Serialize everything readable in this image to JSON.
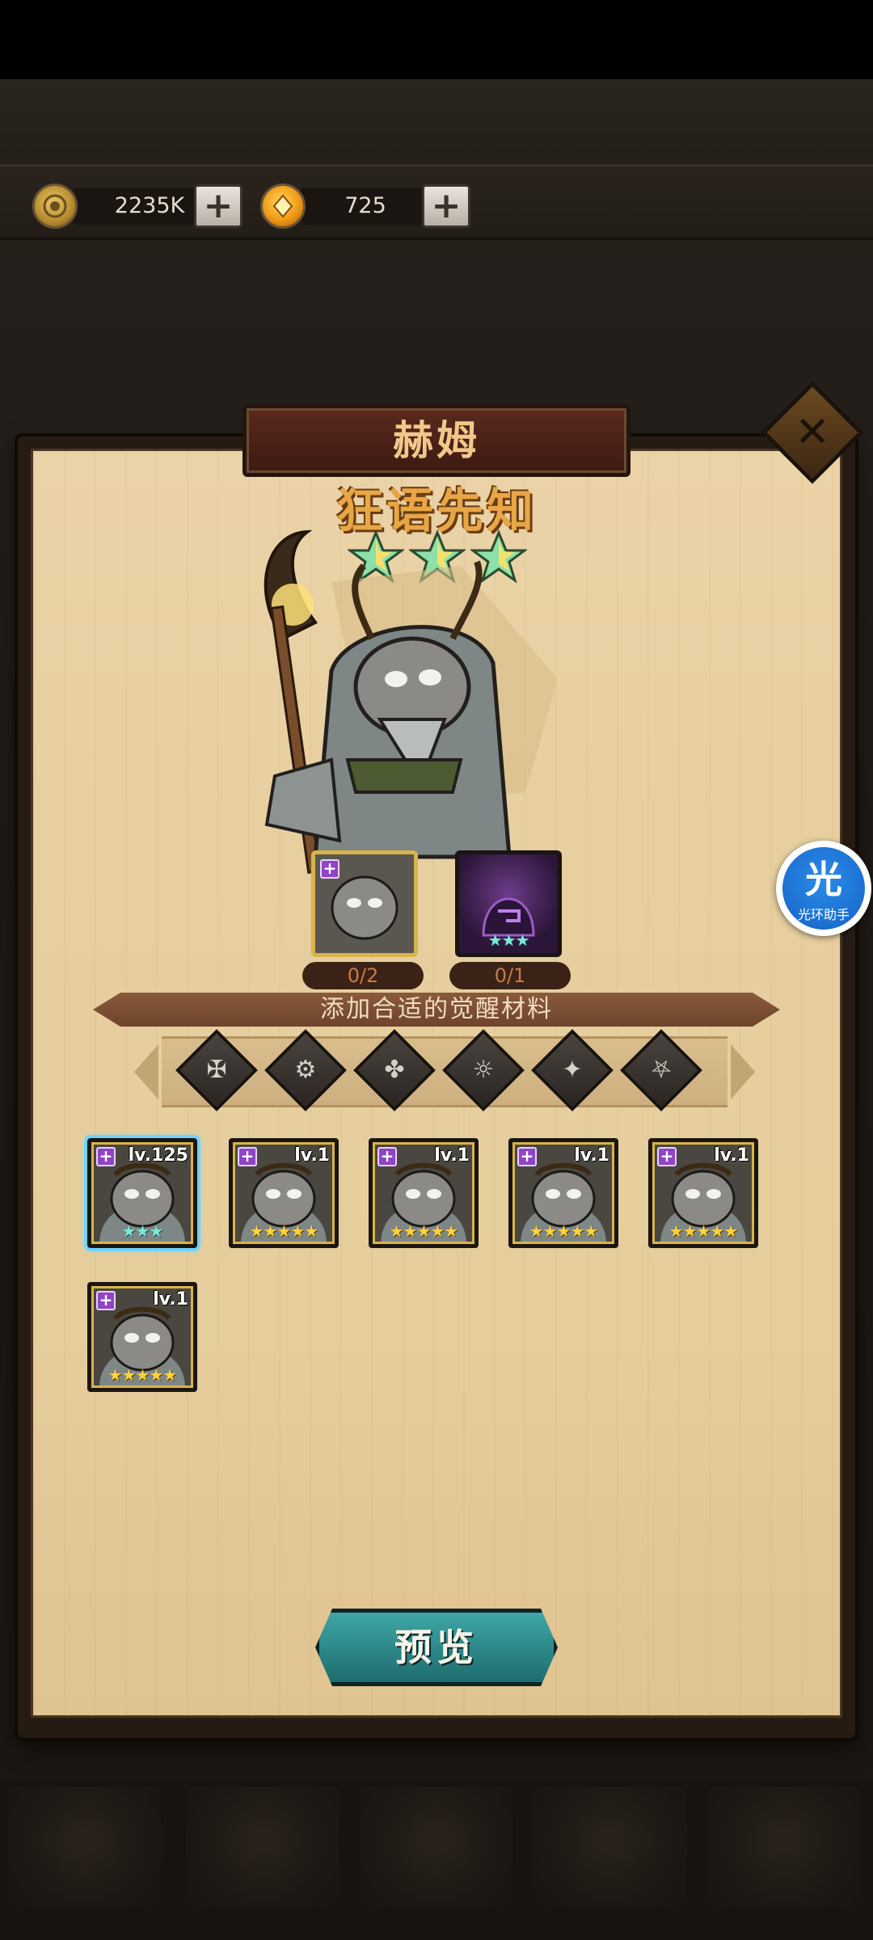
{
  "resources": {
    "gold": {
      "icon": "coin-icon",
      "value": "2235K"
    },
    "gem": {
      "icon": "gem-icon",
      "value": "725"
    }
  },
  "panel": {
    "hero_name": "赫姆",
    "hero_title": "狂语先知",
    "hero_stars": 3,
    "close_icon": "close-icon"
  },
  "awaken_slots": [
    {
      "count": "0/2",
      "frame": "gold"
    },
    {
      "count": "0/1",
      "frame": "purple",
      "stars": "★★★"
    }
  ],
  "material_banner": "添加合适的觉醒材料",
  "filters": [
    "faction-1-icon",
    "faction-2-icon",
    "faction-3-icon",
    "faction-4-icon",
    "faction-5-icon",
    "faction-6-icon"
  ],
  "hero_cards": [
    {
      "level": "lv.125",
      "stars": "★★★",
      "star_color": "cyan",
      "selected": true
    },
    {
      "level": "lv.1",
      "stars": "★★★★★",
      "star_color": "gold",
      "selected": false
    },
    {
      "level": "lv.1",
      "stars": "★★★★★",
      "star_color": "gold",
      "selected": false
    },
    {
      "level": "lv.1",
      "stars": "★★★★★",
      "star_color": "gold",
      "selected": false
    },
    {
      "level": "lv.1",
      "stars": "★★★★★",
      "star_color": "gold",
      "selected": false
    },
    {
      "level": "lv.1",
      "stars": "★★★★★",
      "star_color": "gold",
      "selected": false
    }
  ],
  "preview_button": "预览",
  "assistant": {
    "glyph": "光",
    "label": "光环助手"
  },
  "colors": {
    "parchment": "#e8d0a2",
    "title_plate": "#4a2217",
    "accent_gold": "#d8b34a",
    "preview": "#2c8a8b"
  }
}
